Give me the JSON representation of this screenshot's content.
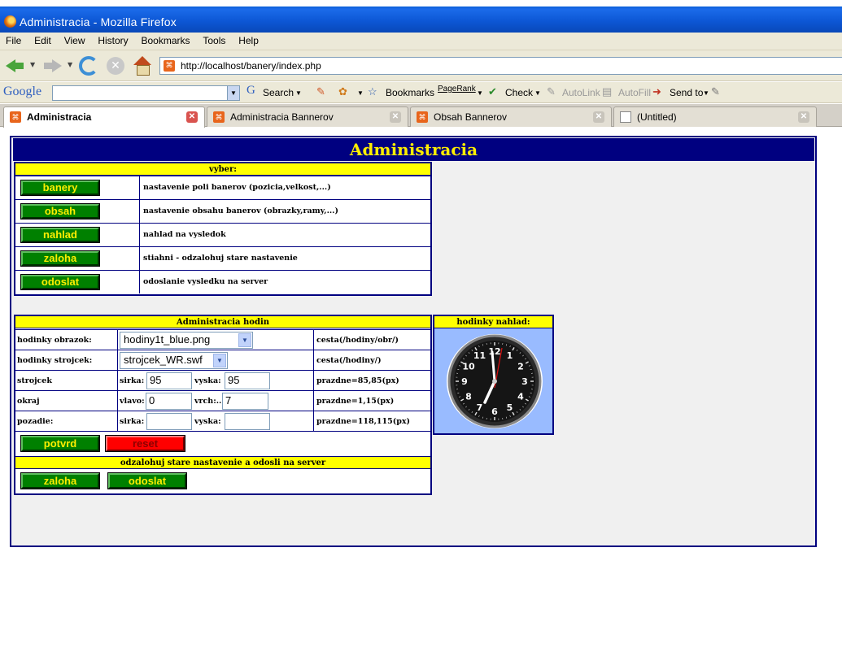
{
  "window": {
    "title": "Administracia - Mozilla Firefox"
  },
  "menu": [
    "File",
    "Edit",
    "View",
    "History",
    "Bookmarks",
    "Tools",
    "Help"
  ],
  "address": {
    "url": "http://localhost/banery/index.php"
  },
  "google_toolbar": {
    "logo": "Google",
    "search": "Search",
    "bookmarks": "Bookmarks",
    "pagerank": "PageRank",
    "check": "Check",
    "autolink": "AutoLink",
    "autofill": "AutoFill",
    "sendto": "Send to"
  },
  "tabs": [
    {
      "label": "Administracia",
      "active": true
    },
    {
      "label": "Administracia Bannerov",
      "active": false
    },
    {
      "label": "Obsah Bannerov",
      "active": false
    },
    {
      "label": "(Untitled)",
      "active": false
    }
  ],
  "page": {
    "title": "Administracia",
    "select_panel": {
      "header": "vyber:",
      "rows": [
        {
          "button": "banery",
          "desc": "nastavenie poli banerov (pozicia,velkost,...)"
        },
        {
          "button": "obsah",
          "desc": "nastavenie obsahu banerov (obrazky,ramy,...)"
        },
        {
          "button": "nahlad",
          "desc": "nahlad na vysledok"
        },
        {
          "button": "zaloha",
          "desc": "stiahni - odzalohuj stare nastavenie"
        },
        {
          "button": "odoslat",
          "desc": "odoslanie vysledku na server"
        }
      ]
    },
    "clock_admin": {
      "header": "Administracia hodin",
      "image_label": "hodinky obrazok:",
      "image_value": "hodiny1t_blue.png",
      "image_path": "cesta(/hodiny/obr/)",
      "movement_label": "hodinky strojcek:",
      "movement_value": "strojcek_WR.swf",
      "movement_path": "cesta(/hodiny/)",
      "strojcek_label": "strojcek",
      "strojcek_width_label": "sirka:",
      "strojcek_width": "95",
      "strojcek_height_label": "vyska:",
      "strojcek_height": "95",
      "strojcek_empty": "prazdne=85,85(px)",
      "okraj_label": "okraj",
      "okraj_left_label": "vlavo:",
      "okraj_left": "0",
      "okraj_top_label": "vrch:..",
      "okraj_top": "7",
      "okraj_empty": "prazdne=1,15(px)",
      "pozadie_label": "pozadie:",
      "pozadie_width_label": "sirka:",
      "pozadie_width": "",
      "pozadie_height_label": "vyska:",
      "pozadie_height": "",
      "pozadie_empty": "prazdne=118,115(px)",
      "confirm_button": "potvrd",
      "reset_button": "reset",
      "backup_header": "odzalohuj stare nastavenie a odosli na server",
      "backup_button": "zaloha",
      "send_button": "odoslat"
    },
    "preview": {
      "header": "hodinky nahlad:",
      "numbers": [
        "12",
        "1",
        "2",
        "3",
        "4",
        "5",
        "6",
        "7",
        "8",
        "9",
        "10",
        "11"
      ]
    }
  },
  "colors": {
    "frame_blue": "#000080",
    "title_yellow": "#ffee00",
    "header_yellow": "#ffff00",
    "button_green": "#008000",
    "button_red": "#ff0000",
    "preview_bg": "#99bbff"
  }
}
